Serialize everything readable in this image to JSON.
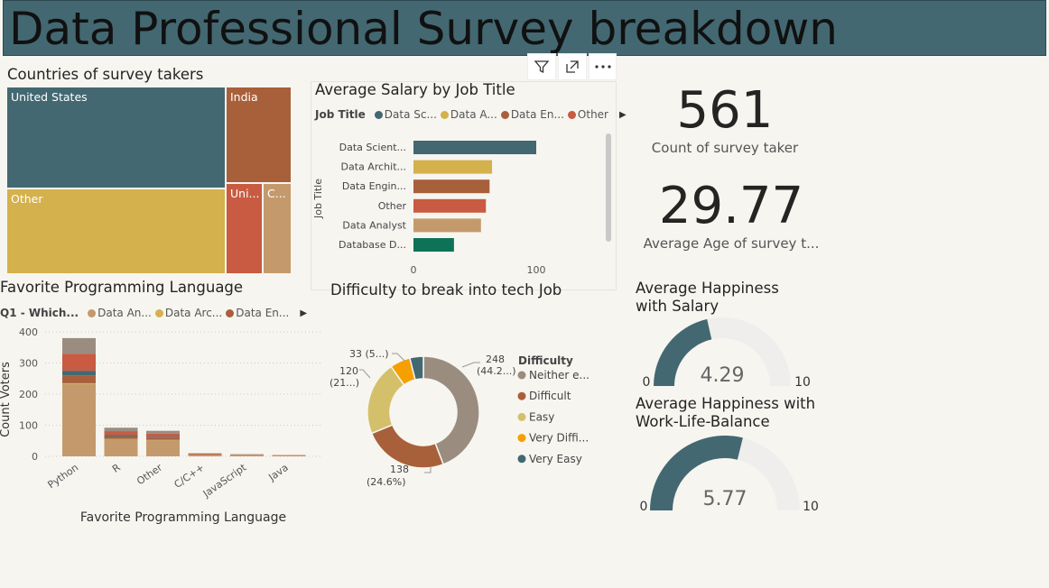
{
  "title": "Data Professional Survey breakdown",
  "colors": {
    "teal": "#436872",
    "gold": "#d4b14c",
    "brown": "#a8603b",
    "red": "#c85b41",
    "tan": "#c49a6c",
    "green": "#0e7356",
    "grey": "#9a8d80"
  },
  "toolbar": {
    "filter_icon": "filter-icon",
    "focus_icon": "focus-mode-icon",
    "more_icon": "more-options-icon"
  },
  "treemap": {
    "title": "Countries of survey takers",
    "cells": [
      {
        "label": "United States",
        "color": "#436872"
      },
      {
        "label": "Other",
        "color": "#d4b14c"
      },
      {
        "label": "India",
        "color": "#a8603b"
      },
      {
        "label": "Uni...",
        "color": "#c85b41"
      },
      {
        "label": "C...",
        "color": "#c49a6c"
      }
    ]
  },
  "salary": {
    "title": "Average Salary by Job Title",
    "legend_title": "Job Title",
    "legend": [
      {
        "label": "Data Sc...",
        "color": "#436872"
      },
      {
        "label": "Data A...",
        "color": "#d4b14c"
      },
      {
        "label": "Data En...",
        "color": "#a8603b"
      },
      {
        "label": "Other",
        "color": "#c85b41"
      }
    ],
    "yaxis_label": "Job Title",
    "xticks": [
      "0",
      "100"
    ]
  },
  "kpis": {
    "count_value": "561",
    "count_label": "Count of survey taker",
    "age_value": "29.77",
    "age_label": "Average Age of survey t..."
  },
  "lang": {
    "title": "Favorite Programming Language",
    "legend_title": "Q1 - Which...",
    "legend": [
      {
        "label": "Data An...",
        "color": "#c49a6c"
      },
      {
        "label": "Data Arc...",
        "color": "#d4b14c"
      },
      {
        "label": "Data En...",
        "color": "#a8603b"
      }
    ],
    "ylabel": "Count Voters",
    "xlabel": "Favorite Programming Language",
    "yticks": [
      "400",
      "300",
      "200",
      "100",
      "0"
    ]
  },
  "difficulty": {
    "title": "Difficulty to break into tech Job",
    "legend_title": "Difficulty",
    "labels": {
      "neither": [
        "248",
        "(44.2...)"
      ],
      "difficult": [
        "138",
        "(24.6%)"
      ],
      "easy": [
        "120",
        "(21...)"
      ],
      "very_difficult": [
        "33 (5...)"
      ]
    }
  },
  "gauges": {
    "salary_title_1": "Average Happiness",
    "salary_title_2": "with Salary",
    "salary_value": "4.29",
    "salary_min": "0",
    "salary_max": "10",
    "wlb_title_1": "Average Happiness with",
    "wlb_title_2": "Work-Life-Balance",
    "wlb_value": "5.77",
    "wlb_min": "0",
    "wlb_max": "10"
  },
  "chart_data": [
    {
      "type": "bar",
      "title": "Average Salary by Job Title",
      "orientation": "horizontal",
      "ylabel": "Job Title",
      "categories": [
        "Data Scient...",
        "Data Archit...",
        "Data Engin...",
        "Other",
        "Data Analyst",
        "Database D..."
      ],
      "values": [
        100,
        64,
        62,
        59,
        55,
        33
      ],
      "colors": [
        "#436872",
        "#d4b14c",
        "#a8603b",
        "#c85b41",
        "#c49a6c",
        "#0e7356"
      ],
      "xlim": [
        0,
        160
      ]
    },
    {
      "type": "bar",
      "stacked": true,
      "title": "Favorite Programming Language",
      "xlabel": "Favorite Programming Language",
      "ylabel": "Count Voters",
      "ylim": [
        0,
        400
      ],
      "categories": [
        "Python",
        "R",
        "Other",
        "C/C++",
        "JavaScript",
        "Java"
      ],
      "series": [
        {
          "name": "Data An...",
          "color": "#c49a6c",
          "values": [
            232,
            55,
            52,
            5,
            4,
            2
          ]
        },
        {
          "name": "Data Arc...",
          "color": "#d4b14c",
          "values": [
            3,
            1,
            1,
            0,
            0,
            0
          ]
        },
        {
          "name": "Data En...",
          "color": "#a8603b",
          "values": [
            25,
            8,
            7,
            2,
            1,
            1
          ]
        },
        {
          "name": "",
          "color": "#436872",
          "values": [
            15,
            5,
            3,
            0,
            0,
            0
          ]
        },
        {
          "name": "",
          "color": "#c85b41",
          "values": [
            55,
            12,
            10,
            2,
            1,
            1
          ]
        },
        {
          "name": "",
          "color": "#9a8d80",
          "values": [
            50,
            11,
            9,
            1,
            1,
            0
          ]
        }
      ]
    },
    {
      "type": "pie",
      "donut": true,
      "title": "Difficulty to break into tech Job",
      "categories": [
        "Neither e...",
        "Difficult",
        "Easy",
        "Very Diffi...",
        "Very Easy"
      ],
      "values": [
        248,
        138,
        120,
        33,
        22
      ],
      "colors": [
        "#9a8d80",
        "#a8603b",
        "#d4c06a",
        "#f5a000",
        "#436872"
      ]
    }
  ]
}
